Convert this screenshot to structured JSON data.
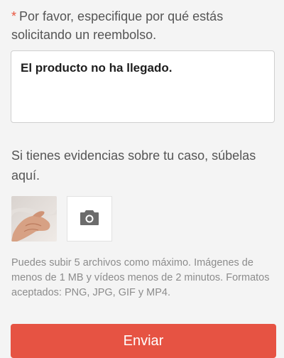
{
  "form": {
    "reason_label_asterisk": "*",
    "reason_label": "Por favor, especifique por qué estás solicitando un reembolso.",
    "reason_value": "El producto no ha llegado.",
    "evidence_label": "Si tienes evidencias sobre tu caso, súbelas aquí.",
    "upload_hint": "Puedes subir 5 archivos como máximo. Imágenes de menos de 1 MB y vídeos menos de 2 minutos. Formatos aceptados: PNG, JPG, GIF y MP4.",
    "submit_label": "Enviar"
  },
  "icons": {
    "upload": "camera-icon"
  },
  "colors": {
    "accent": "#e65343",
    "asterisk": "#e8563f"
  }
}
